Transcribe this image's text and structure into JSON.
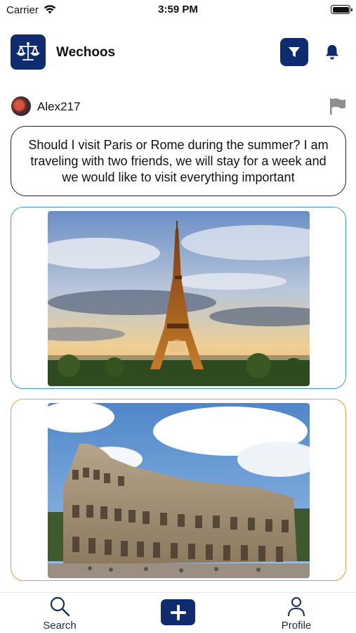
{
  "status_bar": {
    "carrier": "Carrier",
    "time": "3:59 PM",
    "battery_level": 1.0
  },
  "header": {
    "app_title": "Wechoos",
    "logo_icon": "scales-of-justice-icon",
    "filter_icon": "filter-icon",
    "notification_icon": "bell-icon"
  },
  "post": {
    "username": "Alex217",
    "flag_icon": "flag-icon",
    "question": "Should I visit Paris or Rome during the summer? I am traveling with two friends, we will stay for a week and we would like to visit everything important",
    "options": [
      {
        "image": "eiffel-tower-photo",
        "border_color": "#3b9bd8"
      },
      {
        "image": "colosseum-photo",
        "border_color": "#ef9a3c"
      }
    ]
  },
  "tab_bar": {
    "search_label": "Search",
    "add_icon": "plus-icon",
    "profile_label": "Profile"
  },
  "colors": {
    "brand": "#0f2c6e",
    "option_a": "#3b9bd8",
    "option_b": "#ef9a3c"
  }
}
